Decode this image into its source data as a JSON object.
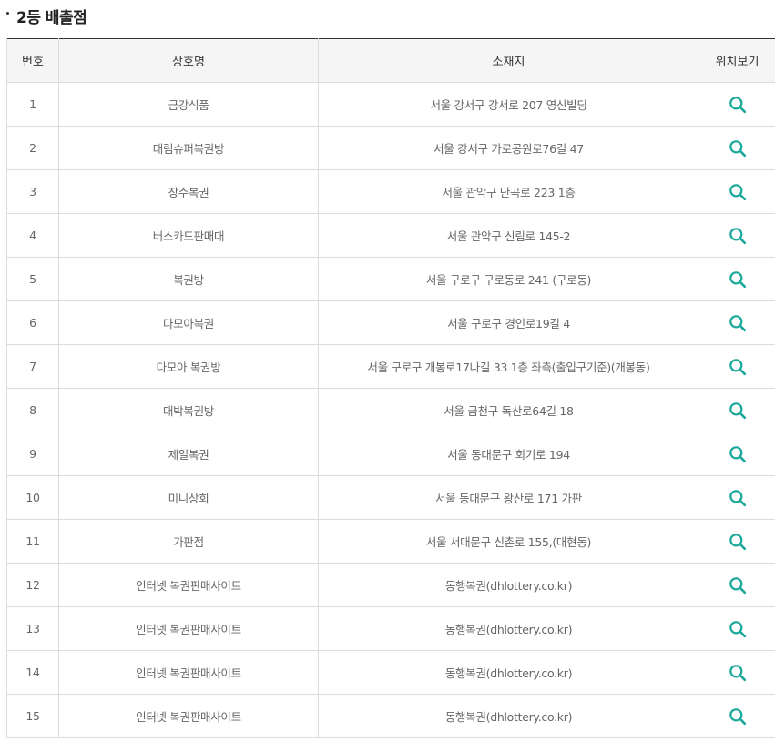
{
  "section": {
    "title": "2등 배출점"
  },
  "table": {
    "headers": {
      "no": "번호",
      "name": "상호명",
      "address": "소재지",
      "map": "위치보기"
    },
    "accent_color": "#1aa89a",
    "rows": [
      {
        "no": "1",
        "name": "금강식품",
        "address": "서울 강서구 강서로 207 영신빌딩"
      },
      {
        "no": "2",
        "name": "대림슈퍼복권방",
        "address": "서울 강서구 가로공원로76길 47"
      },
      {
        "no": "3",
        "name": "장수복권",
        "address": "서울 관악구 난곡로 223 1층"
      },
      {
        "no": "4",
        "name": "버스카드판매대",
        "address": "서울 관악구 신림로 145-2"
      },
      {
        "no": "5",
        "name": "복권방",
        "address": "서울 구로구 구로동로 241 (구로동)"
      },
      {
        "no": "6",
        "name": "다모아복권",
        "address": "서울 구로구 경인로19길 4"
      },
      {
        "no": "7",
        "name": "다모아 복권방",
        "address": "서울 구로구 개봉로17나길 33 1층 좌측(출입구기준)(개봉동)"
      },
      {
        "no": "8",
        "name": "대박복권방",
        "address": "서울 금천구 독산로64길 18"
      },
      {
        "no": "9",
        "name": "제일복권",
        "address": "서울 동대문구 회기로 194"
      },
      {
        "no": "10",
        "name": "미니상회",
        "address": "서울 동대문구 왕산로 171 가판"
      },
      {
        "no": "11",
        "name": "가판점",
        "address": "서울 서대문구 신촌로 155,(대현동)"
      },
      {
        "no": "12",
        "name": "인터넷 복권판매사이트",
        "address": "동행복권(dhlottery.co.kr)"
      },
      {
        "no": "13",
        "name": "인터넷 복권판매사이트",
        "address": "동행복권(dhlottery.co.kr)"
      },
      {
        "no": "14",
        "name": "인터넷 복권판매사이트",
        "address": "동행복권(dhlottery.co.kr)"
      },
      {
        "no": "15",
        "name": "인터넷 복권판매사이트",
        "address": "동행복권(dhlottery.co.kr)"
      }
    ],
    "map_icon": "search-icon"
  }
}
